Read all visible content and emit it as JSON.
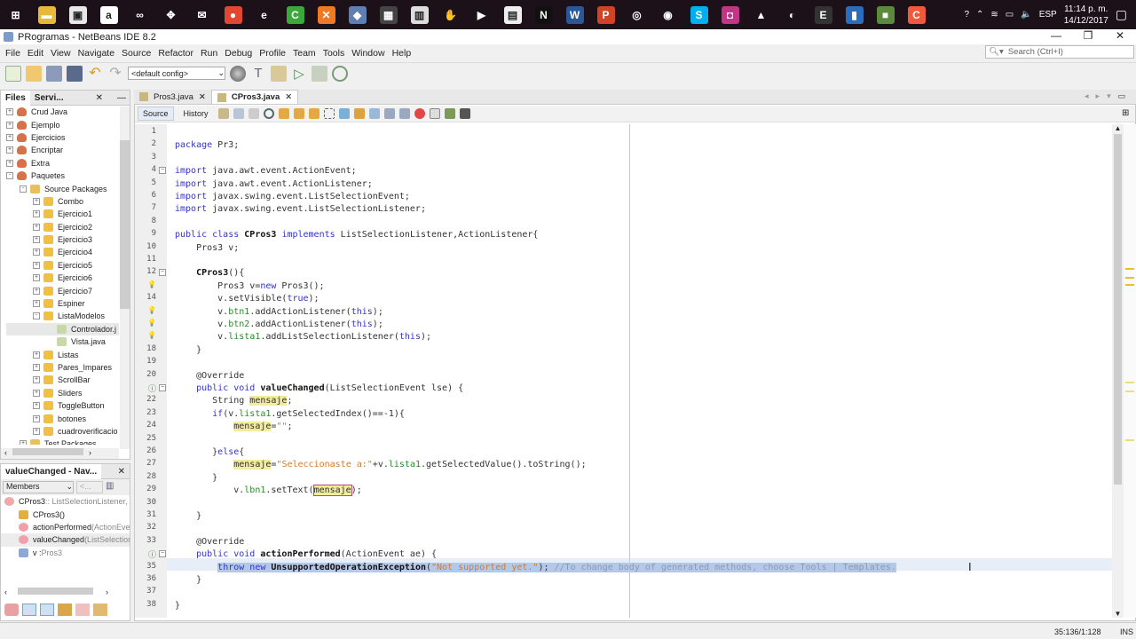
{
  "taskbar": {
    "apps": [
      {
        "name": "start",
        "glyph": "⊞",
        "color": "#1c1019"
      },
      {
        "name": "file-explorer",
        "glyph": "▬",
        "color": "#e8b83a"
      },
      {
        "name": "store",
        "glyph": "▣",
        "color": "#e8e8e8"
      },
      {
        "name": "amazon",
        "glyph": "a",
        "color": "#ffffff"
      },
      {
        "name": "infinity",
        "glyph": "∞",
        "color": "#1c1019"
      },
      {
        "name": "dropbox",
        "glyph": "✥",
        "color": "#1c1019"
      },
      {
        "name": "mail",
        "glyph": "✉",
        "color": "#1c1019"
      },
      {
        "name": "chrome",
        "glyph": "●",
        "color": "#e4472f"
      },
      {
        "name": "edge",
        "glyph": "e",
        "color": "#1c1019"
      },
      {
        "name": "camtasia",
        "glyph": "C",
        "color": "#3aa83a"
      },
      {
        "name": "xampp",
        "glyph": "✕",
        "color": "#f07a24"
      },
      {
        "name": "netbeans",
        "glyph": "◆",
        "color": "#5f7fb0"
      },
      {
        "name": "app-a",
        "glyph": "▦",
        "color": "#444"
      },
      {
        "name": "app-b",
        "glyph": "▥",
        "color": "#ddd"
      },
      {
        "name": "app-c",
        "glyph": "✋",
        "color": "#1c1019"
      },
      {
        "name": "media-player",
        "glyph": "▶",
        "color": "#1c1019"
      },
      {
        "name": "app-d",
        "glyph": "▤",
        "color": "#eee"
      },
      {
        "name": "netflix",
        "glyph": "N",
        "color": "#111"
      },
      {
        "name": "word",
        "glyph": "W",
        "color": "#2b579a"
      },
      {
        "name": "powerpoint",
        "glyph": "P",
        "color": "#d04423"
      },
      {
        "name": "app-e",
        "glyph": "◎",
        "color": "#1c1019"
      },
      {
        "name": "maps",
        "glyph": "◉",
        "color": "#1c1019"
      },
      {
        "name": "skype",
        "glyph": "S",
        "color": "#00aff0"
      },
      {
        "name": "instagram",
        "glyph": "◘",
        "color": "#c13584"
      },
      {
        "name": "photos",
        "glyph": "▲",
        "color": "#1c1019"
      },
      {
        "name": "steam",
        "glyph": "◐",
        "color": "#1c1019"
      },
      {
        "name": "epic",
        "glyph": "E",
        "color": "#333"
      },
      {
        "name": "app-f",
        "glyph": "▮",
        "color": "#2a6ebb"
      },
      {
        "name": "minecraft",
        "glyph": "■",
        "color": "#5a8a3a"
      },
      {
        "name": "app-g",
        "glyph": "C",
        "color": "#f05a3a"
      }
    ],
    "tray": {
      "lang": "ESP",
      "time": "11:14 p. m.",
      "date": "14/12/2017"
    }
  },
  "window": {
    "title": "PRogramas - NetBeans IDE 8.2",
    "search_placeholder": "Search (Ctrl+I)"
  },
  "menu": [
    "File",
    "Edit",
    "View",
    "Navigate",
    "Source",
    "Refactor",
    "Run",
    "Debug",
    "Profile",
    "Team",
    "Tools",
    "Window",
    "Help"
  ],
  "toolbar": {
    "config": "<default config>"
  },
  "projects": {
    "tabs": [
      "Files",
      "Servi..."
    ],
    "items": [
      {
        "label": "Crud Java",
        "level": 0,
        "toggle": "+",
        "icon": "project"
      },
      {
        "label": "Ejemplo",
        "level": 0,
        "toggle": "+",
        "icon": "project"
      },
      {
        "label": "Ejercicios",
        "level": 0,
        "toggle": "+",
        "icon": "project"
      },
      {
        "label": "Encriptar",
        "level": 0,
        "toggle": "+",
        "icon": "project"
      },
      {
        "label": "Extra",
        "level": 0,
        "toggle": "+",
        "icon": "project"
      },
      {
        "label": "Paquetes",
        "level": 0,
        "toggle": "-",
        "icon": "project"
      },
      {
        "label": "Source Packages",
        "level": 1,
        "toggle": "-",
        "icon": "srcpkg"
      },
      {
        "label": "Combo",
        "level": 2,
        "toggle": "+",
        "icon": "package"
      },
      {
        "label": "Ejercicio1",
        "level": 2,
        "toggle": "+",
        "icon": "package"
      },
      {
        "label": "Ejercicio2",
        "level": 2,
        "toggle": "+",
        "icon": "package"
      },
      {
        "label": "Ejercicio3",
        "level": 2,
        "toggle": "+",
        "icon": "package"
      },
      {
        "label": "Ejercicio4",
        "level": 2,
        "toggle": "+",
        "icon": "package"
      },
      {
        "label": "Ejercicio5",
        "level": 2,
        "toggle": "+",
        "icon": "package"
      },
      {
        "label": "Ejercicio6",
        "level": 2,
        "toggle": "+",
        "icon": "package"
      },
      {
        "label": "Ejercicio7",
        "level": 2,
        "toggle": "+",
        "icon": "package"
      },
      {
        "label": "Espiner",
        "level": 2,
        "toggle": "+",
        "icon": "package"
      },
      {
        "label": "ListaModelos",
        "level": 2,
        "toggle": "-",
        "icon": "package"
      },
      {
        "label": "Controlador.j",
        "level": 3,
        "toggle": "",
        "icon": "java",
        "selected": true
      },
      {
        "label": "Vista.java",
        "level": 3,
        "toggle": "",
        "icon": "java"
      },
      {
        "label": "Listas",
        "level": 2,
        "toggle": "+",
        "icon": "package"
      },
      {
        "label": "Pares_Impares",
        "level": 2,
        "toggle": "+",
        "icon": "package"
      },
      {
        "label": "ScrollBar",
        "level": 2,
        "toggle": "+",
        "icon": "package"
      },
      {
        "label": "Sliders",
        "level": 2,
        "toggle": "+",
        "icon": "package"
      },
      {
        "label": "ToggleButton",
        "level": 2,
        "toggle": "+",
        "icon": "package"
      },
      {
        "label": "botones",
        "level": 2,
        "toggle": "+",
        "icon": "package"
      },
      {
        "label": "cuadroverificacio",
        "level": 2,
        "toggle": "+",
        "icon": "package"
      },
      {
        "label": "Test Packages",
        "level": 1,
        "toggle": "+",
        "icon": "srcpkg"
      }
    ]
  },
  "navigator": {
    "title": "valueChanged - Nav...",
    "filter": "Members",
    "filter2": "<...",
    "root": {
      "name": "CPros3",
      "detail": " :: ListSelectionListener, A"
    },
    "items": [
      {
        "name": "CPros3()",
        "detail": "",
        "icon": "constructor"
      },
      {
        "name": "actionPerformed",
        "detail": "(ActionEvent",
        "icon": "method"
      },
      {
        "name": "valueChanged",
        "detail": "(ListSelectionE",
        "icon": "method",
        "selected": true
      },
      {
        "name": "v : ",
        "detail": "Pros3",
        "icon": "field"
      }
    ]
  },
  "editor": {
    "tabs": [
      {
        "label": "Pros3.java",
        "active": false
      },
      {
        "label": "CPros3.java",
        "active": true
      }
    ],
    "source": "Source",
    "history": "History",
    "lines": [
      [],
      [
        [
          "k",
          "package"
        ],
        [
          "p",
          " Pr3;"
        ]
      ],
      [],
      [
        [
          "k",
          "import"
        ],
        [
          "p",
          " java.awt.event.ActionEvent;"
        ]
      ],
      [
        [
          "k",
          "import"
        ],
        [
          "p",
          " java.awt.event.ActionListener;"
        ]
      ],
      [
        [
          "k",
          "import"
        ],
        [
          "p",
          " javax.swing.event.ListSelectionEvent;"
        ]
      ],
      [
        [
          "k",
          "import"
        ],
        [
          "p",
          " javax.swing.event.ListSelectionListener;"
        ]
      ],
      [],
      [
        [
          "k",
          "public class "
        ],
        [
          "b",
          "CPros3 "
        ],
        [
          "k",
          "implements"
        ],
        [
          "p",
          " ListSelectionListener,ActionListener{"
        ]
      ],
      [
        [
          "p",
          "    Pros3 v;"
        ]
      ],
      [],
      [
        [
          "p",
          "    "
        ],
        [
          "b",
          "CPros3"
        ],
        [
          "p",
          "(){"
        ]
      ],
      [
        [
          "p",
          "        Pros3 v="
        ],
        [
          "k",
          "new"
        ],
        [
          "p",
          " Pros3();"
        ]
      ],
      [
        [
          "p",
          "        v.setVisible("
        ],
        [
          "k",
          "true"
        ],
        [
          "p",
          ");"
        ]
      ],
      [
        [
          "p",
          "        v."
        ],
        [
          "f",
          "btn1"
        ],
        [
          "p",
          ".addActionListener("
        ],
        [
          "k",
          "this"
        ],
        [
          "p",
          ");"
        ]
      ],
      [
        [
          "p",
          "        v."
        ],
        [
          "f",
          "btn2"
        ],
        [
          "p",
          ".addActionListener("
        ],
        [
          "k",
          "this"
        ],
        [
          "p",
          ");"
        ]
      ],
      [
        [
          "p",
          "        v."
        ],
        [
          "f",
          "lista1"
        ],
        [
          "p",
          ".addListSelectionListener("
        ],
        [
          "k",
          "this"
        ],
        [
          "p",
          ");"
        ]
      ],
      [
        [
          "p",
          "    }"
        ]
      ],
      [],
      [
        [
          "p",
          "    @Override"
        ]
      ],
      [
        [
          "p",
          "    "
        ],
        [
          "k",
          "public void "
        ],
        [
          "b",
          "valueChanged"
        ],
        [
          "p",
          "(ListSelectionEvent lse) {"
        ]
      ],
      [
        [
          "p",
          "       String "
        ],
        [
          "h",
          "mensaje"
        ],
        [
          "p",
          ";"
        ]
      ],
      [
        [
          "p",
          "       "
        ],
        [
          "k",
          "if"
        ],
        [
          "p",
          "(v."
        ],
        [
          "f",
          "lista1"
        ],
        [
          "p",
          ".getSelectedIndex()==-1){"
        ]
      ],
      [
        [
          "p",
          "           "
        ],
        [
          "h",
          "mensaje"
        ],
        [
          "p",
          "="
        ],
        [
          "s",
          "\"\""
        ],
        [
          "p",
          ";"
        ]
      ],
      [],
      [
        [
          "p",
          "       }"
        ],
        [
          "k",
          "else"
        ],
        [
          "p",
          "{"
        ]
      ],
      [
        [
          "p",
          "           "
        ],
        [
          "h",
          "mensaje"
        ],
        [
          "p",
          "="
        ],
        [
          "s",
          "\"Seleccionaste a:\""
        ],
        [
          "p",
          "+v."
        ],
        [
          "f",
          "lista1"
        ],
        [
          "p",
          ".getSelectedValue().toString();"
        ]
      ],
      [
        [
          "p",
          "       }"
        ]
      ],
      [
        [
          "p",
          "           v."
        ],
        [
          "f",
          "lbn1"
        ],
        [
          "p",
          ".setText("
        ],
        [
          "hb",
          "mensaje"
        ],
        [
          "p",
          ");"
        ]
      ],
      [],
      [
        [
          "p",
          "    }"
        ]
      ],
      [],
      [
        [
          "p",
          "    @Override"
        ]
      ],
      [
        [
          "p",
          "    "
        ],
        [
          "k",
          "public void "
        ],
        [
          "b",
          "actionPerformed"
        ],
        [
          "p",
          "(ActionEvent ae) {"
        ]
      ],
      [
        [
          "p",
          "        "
        ],
        [
          "k",
          "throw new "
        ],
        [
          "b",
          "UnsupportedOperationException"
        ],
        [
          "p",
          "("
        ],
        [
          "s",
          "\"Not supported yet.\""
        ],
        [
          "p",
          "); "
        ],
        [
          "c",
          "//To change body of generated methods, choose Tools | Templates."
        ]
      ],
      [
        [
          "p",
          "    }"
        ]
      ],
      [],
      [
        [
          "p",
          "}"
        ]
      ]
    ]
  },
  "status": {
    "position": "35:136/1:128",
    "mode": "INS"
  }
}
